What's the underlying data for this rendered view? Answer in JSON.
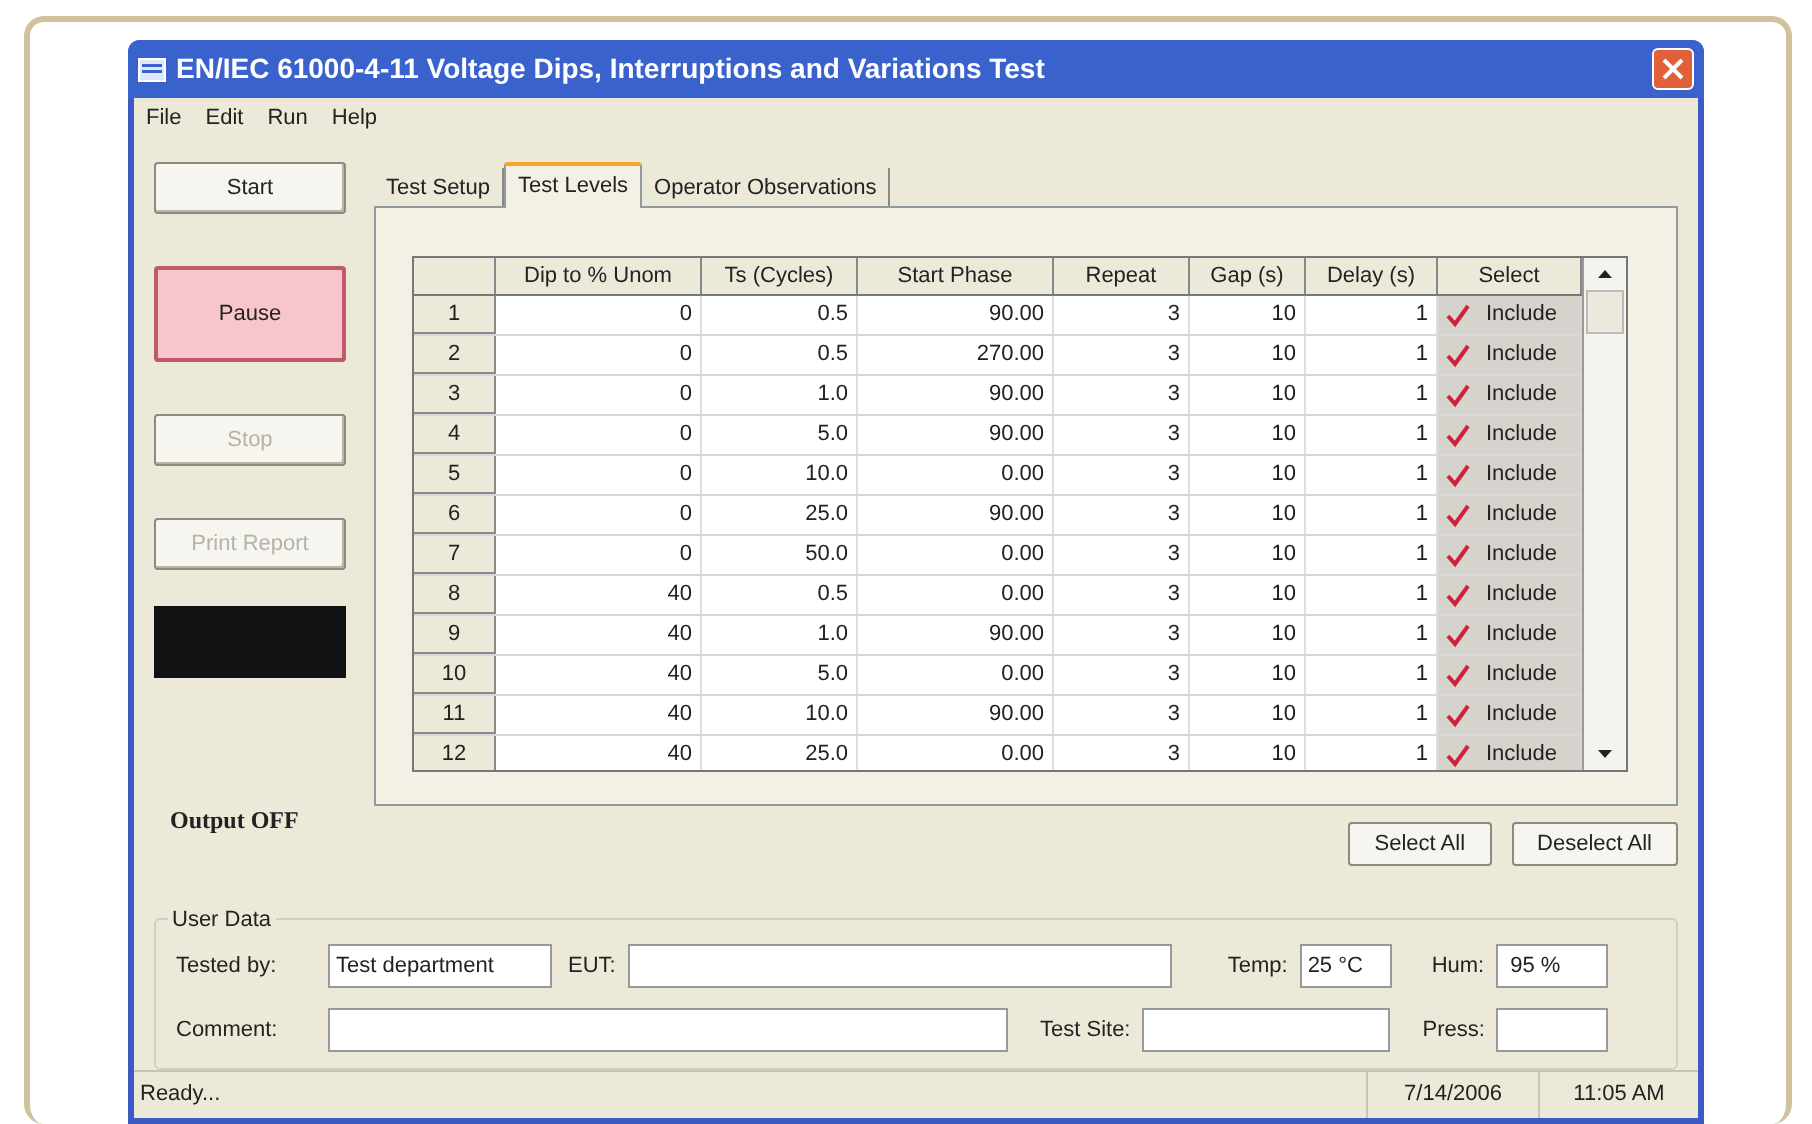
{
  "window": {
    "title": "EN/IEC 61000-4-11 Voltage Dips, Interruptions and Variations Test"
  },
  "menu": [
    "File",
    "Edit",
    "Run",
    "Help"
  ],
  "side_buttons": [
    {
      "label": "Start",
      "kind": "normal",
      "disabled": false
    },
    {
      "label": "Pause",
      "kind": "pressed",
      "disabled": false
    },
    {
      "label": "Stop",
      "kind": "normal",
      "disabled": true
    },
    {
      "label": "Print Report",
      "kind": "normal",
      "disabled": true
    }
  ],
  "output_status": "Output OFF",
  "tabs": [
    {
      "label": "Test Setup",
      "selected": false
    },
    {
      "label": "Test Levels",
      "selected": true
    },
    {
      "label": "Operator Observations",
      "selected": false
    }
  ],
  "table": {
    "columns": [
      "Dip to % Unom",
      "Ts (Cycles)",
      "Start Phase",
      "Repeat",
      "Gap (s)",
      "Delay (s)",
      "Select"
    ],
    "rows": [
      {
        "index": "1",
        "cells": [
          "0",
          "0.5",
          "90.00",
          "3",
          "10",
          "1"
        ],
        "select": "Include",
        "checked": true
      },
      {
        "index": "2",
        "cells": [
          "0",
          "0.5",
          "270.00",
          "3",
          "10",
          "1"
        ],
        "select": "Include",
        "checked": true
      },
      {
        "index": "3",
        "cells": [
          "0",
          "1.0",
          "90.00",
          "3",
          "10",
          "1"
        ],
        "select": "Include",
        "checked": true
      },
      {
        "index": "4",
        "cells": [
          "0",
          "5.0",
          "90.00",
          "3",
          "10",
          "1"
        ],
        "select": "Include",
        "checked": true
      },
      {
        "index": "5",
        "cells": [
          "0",
          "10.0",
          "0.00",
          "3",
          "10",
          "1"
        ],
        "select": "Include",
        "checked": true
      },
      {
        "index": "6",
        "cells": [
          "0",
          "25.0",
          "90.00",
          "3",
          "10",
          "1"
        ],
        "select": "Include",
        "checked": true
      },
      {
        "index": "7",
        "cells": [
          "0",
          "50.0",
          "0.00",
          "3",
          "10",
          "1"
        ],
        "select": "Include",
        "checked": true
      },
      {
        "index": "8",
        "cells": [
          "40",
          "0.5",
          "0.00",
          "3",
          "10",
          "1"
        ],
        "select": "Include",
        "checked": true
      },
      {
        "index": "9",
        "cells": [
          "40",
          "1.0",
          "90.00",
          "3",
          "10",
          "1"
        ],
        "select": "Include",
        "checked": true
      },
      {
        "index": "10",
        "cells": [
          "40",
          "5.0",
          "0.00",
          "3",
          "10",
          "1"
        ],
        "select": "Include",
        "checked": true
      },
      {
        "index": "11",
        "cells": [
          "40",
          "10.0",
          "90.00",
          "3",
          "10",
          "1"
        ],
        "select": "Include",
        "checked": true
      },
      {
        "index": "12",
        "cells": [
          "40",
          "25.0",
          "0.00",
          "3",
          "10",
          "1"
        ],
        "select": "Include",
        "checked": true
      }
    ]
  },
  "table_buttons": [
    "Select All",
    "Deselect All"
  ],
  "user_data": {
    "title": "User Data",
    "tested_by": {
      "label": "Tested by:",
      "value": "Test department"
    },
    "eut": {
      "label": "EUT:"
    },
    "temp": {
      "label": "Temp:",
      "value": "25 °C"
    },
    "hum": {
      "label": "Hum:",
      "value": "95 %"
    },
    "comment": {
      "label": "Comment:"
    },
    "test_site": {
      "label": "Test Site:"
    },
    "press": {
      "label": "Press:"
    }
  },
  "status_bar": {
    "message": "Ready...",
    "date": "7/14/2006",
    "time": "11:05 AM"
  }
}
